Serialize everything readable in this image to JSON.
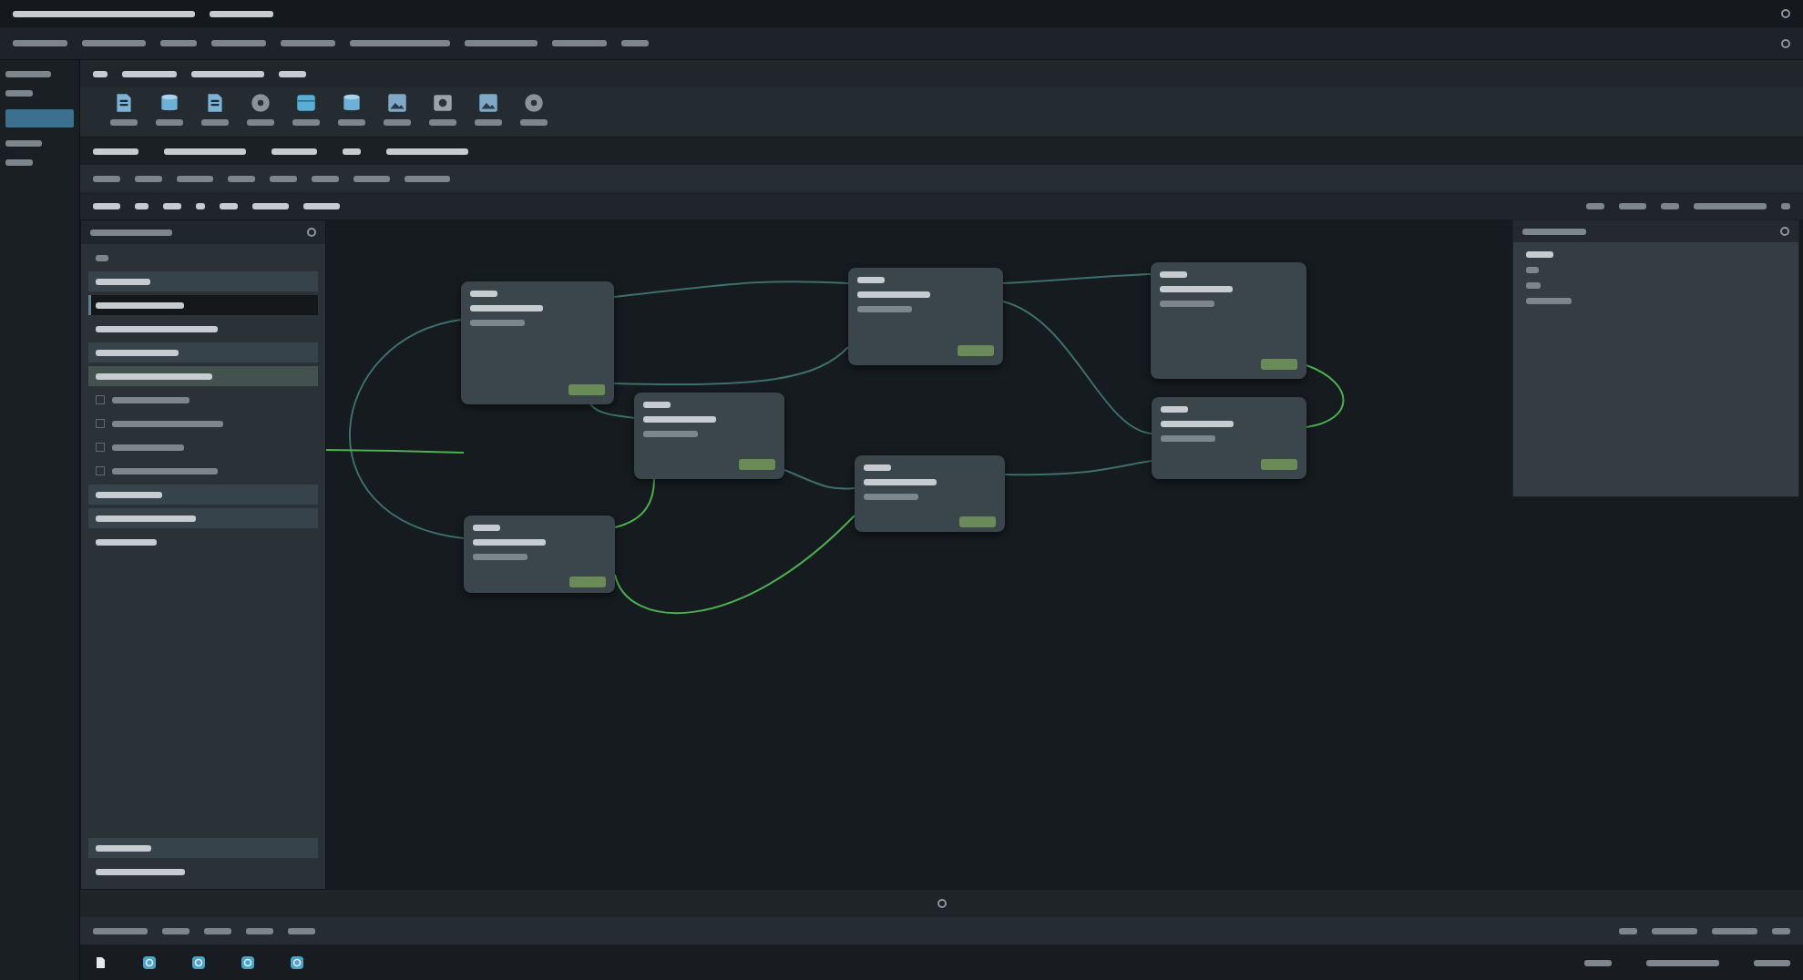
{
  "toolbar": {
    "tools": [
      {
        "kind": "document"
      },
      {
        "kind": "cylinder"
      },
      {
        "kind": "document"
      },
      {
        "kind": "disc"
      },
      {
        "kind": "box"
      },
      {
        "kind": "cylinder"
      },
      {
        "kind": "image"
      },
      {
        "kind": "media"
      },
      {
        "kind": "image"
      },
      {
        "kind": "disc"
      }
    ]
  },
  "sidebar": {
    "rows": [
      {
        "kind": "header",
        "selected": false
      },
      {
        "kind": "item",
        "selected": true
      },
      {
        "kind": "item",
        "selected": false
      },
      {
        "kind": "header",
        "selected": false
      },
      {
        "kind": "item",
        "selected": true
      },
      {
        "kind": "check",
        "selected": false
      },
      {
        "kind": "check",
        "selected": false
      },
      {
        "kind": "check",
        "selected": false
      },
      {
        "kind": "check",
        "selected": false
      },
      {
        "kind": "header",
        "selected": false
      },
      {
        "kind": "header",
        "selected": false
      },
      {
        "kind": "item",
        "selected": false
      },
      {
        "kind": "gap",
        "selected": false
      },
      {
        "kind": "header",
        "selected": false
      },
      {
        "kind": "item",
        "selected": false
      }
    ]
  },
  "graph": {
    "nodes": [
      {
        "kind": "plain"
      },
      {
        "kind": "plain"
      },
      {
        "kind": "plain"
      },
      {
        "kind": "plain"
      },
      {
        "kind": "plain"
      },
      {
        "kind": "plain"
      },
      {
        "kind": "plain"
      }
    ],
    "edges": [
      {
        "color": "#3d6f6c"
      },
      {
        "color": "#3d6f6c"
      },
      {
        "color": "#3d6f6c"
      },
      {
        "color": "#3d6f6c"
      },
      {
        "color": "#3d6f6c"
      },
      {
        "color": "#3d6f6c"
      },
      {
        "color": "#4caf50"
      },
      {
        "color": "#4caf50"
      },
      {
        "color": "#3d6f6c"
      },
      {
        "color": "#4caf50"
      },
      {
        "color": "#4caf50"
      },
      {
        "color": "#3d6f6c"
      }
    ]
  },
  "taskbar": {
    "apps": [
      {
        "kind": "file"
      },
      {
        "kind": "ring"
      },
      {
        "kind": "ring"
      },
      {
        "kind": "ring"
      },
      {
        "kind": "ring"
      }
    ]
  }
}
